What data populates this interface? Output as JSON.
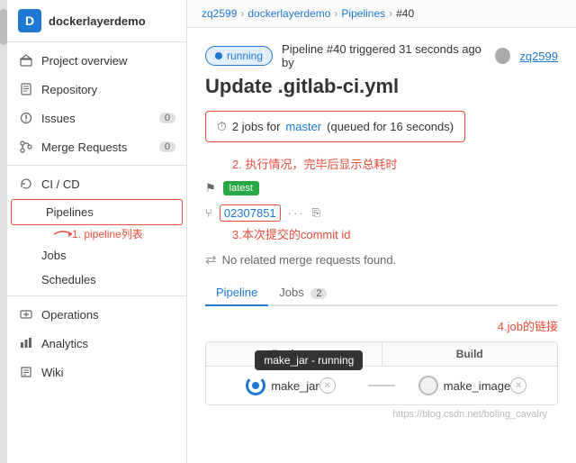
{
  "sidebar": {
    "project_avatar": "D",
    "project_name": "dockerlayerdemo",
    "items": [
      {
        "id": "project-overview",
        "label": "Project overview",
        "icon": "home",
        "badge": null
      },
      {
        "id": "repository",
        "label": "Repository",
        "icon": "book",
        "badge": null
      },
      {
        "id": "issues",
        "label": "Issues",
        "icon": "issue",
        "badge": "0"
      },
      {
        "id": "merge-requests",
        "label": "Merge Requests",
        "icon": "merge",
        "badge": "0"
      },
      {
        "id": "ci-cd",
        "label": "CI / CD",
        "icon": "cicd",
        "badge": null
      },
      {
        "id": "pipelines",
        "label": "Pipelines",
        "icon": null,
        "badge": null,
        "sub": true,
        "active": true,
        "highlighted": true
      },
      {
        "id": "jobs",
        "label": "Jobs",
        "icon": null,
        "badge": null,
        "sub": true
      },
      {
        "id": "schedules",
        "label": "Schedules",
        "icon": null,
        "badge": null,
        "sub": true
      },
      {
        "id": "operations",
        "label": "Operations",
        "icon": "operations",
        "badge": null
      },
      {
        "id": "analytics",
        "label": "Analytics",
        "icon": "analytics",
        "badge": null
      },
      {
        "id": "wiki",
        "label": "Wiki",
        "icon": "wiki",
        "badge": null
      }
    ]
  },
  "breadcrumb": {
    "user": "zq2599",
    "project": "dockerlayerdemo",
    "section": "Pipelines",
    "current": "#40"
  },
  "pipeline": {
    "status": "running",
    "status_label": "running",
    "trigger_text": "Pipeline #40 triggered 31 seconds ago by",
    "user_name": "zq2599",
    "title": "Update .gitlab-ci.yml",
    "jobs_info": "2 jobs for",
    "branch": "master",
    "queue_info": "(queued for 16 seconds)",
    "annotation2": "2. 执行情况，完毕后显示总耗时",
    "latest_badge": "latest",
    "commit_id": "02307851",
    "annotation3": "3.本次提交的commit id",
    "no_mr_text": "No related merge requests found.",
    "tabs": [
      {
        "label": "Pipeline",
        "count": null,
        "active": true
      },
      {
        "label": "Jobs",
        "count": "2",
        "active": false
      }
    ],
    "annotation4": "4.job的链接",
    "annotation1": "1. pipeline列表",
    "stages": [
      {
        "label": "Package"
      },
      {
        "label": "Build"
      }
    ],
    "jobs": [
      {
        "id": "make_jar",
        "status": "running",
        "tooltip": "make_jar - running"
      },
      {
        "id": "make_image",
        "status": "pending"
      }
    ],
    "watermark": "https://blog.csdn.net/boling_cavalry"
  }
}
